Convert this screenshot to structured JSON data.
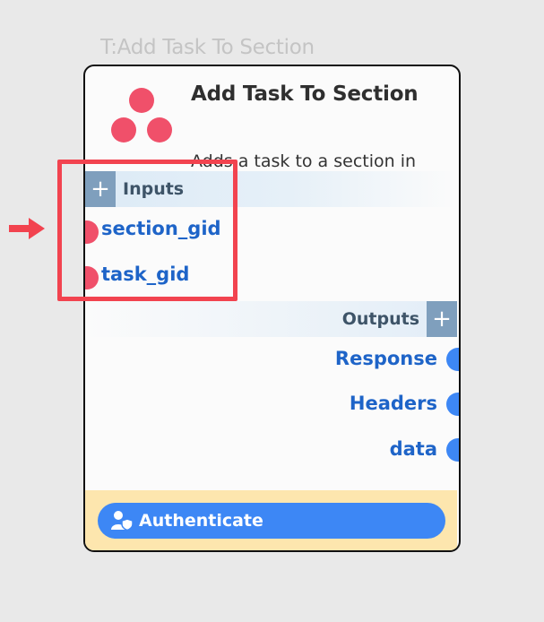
{
  "node": {
    "outer_title": "T:Add Task To Section",
    "title": "Add Task To Section",
    "description": "Adds a task to a section in"
  },
  "inputs": {
    "label": "Inputs",
    "add_symbol": "+",
    "ports": [
      {
        "label": "section_gid"
      },
      {
        "label": "task_gid"
      }
    ]
  },
  "outputs": {
    "label": "Outputs",
    "add_symbol": "+",
    "ports": [
      {
        "label": "Response"
      },
      {
        "label": "Headers"
      },
      {
        "label": "data"
      }
    ]
  },
  "footer": {
    "auth_label": "Authenticate"
  },
  "icons": {
    "logo": "asana-logo-icon",
    "auth": "user-shield-icon",
    "arrow": "arrow-right-icon"
  },
  "colors": {
    "input_port": "#f0506a",
    "output_port": "#3d87f5",
    "port_label": "#1e64c8",
    "highlight": "#f2434f",
    "auth_button": "#3d87f5",
    "footer_bg": "#fde6ae",
    "plus_button": "#7f9fbd",
    "logo": "#f0506a"
  }
}
